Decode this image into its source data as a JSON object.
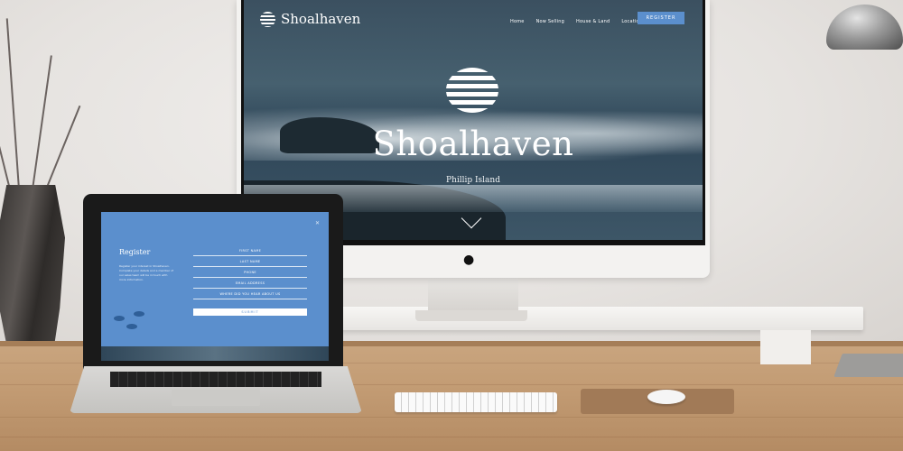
{
  "site": {
    "logo_text": "Shoalhaven",
    "logo_icon": "striped-sun-logo",
    "nav": [
      "Home",
      "Now Selling",
      "House & Land",
      "Location"
    ],
    "register_button": "REGISTER",
    "hero_title": "Shoalhaven",
    "hero_subtitle": "Phillip Island",
    "scroll_icon": "chevron-down-icon"
  },
  "laptop_form": {
    "heading": "Register",
    "intro": "Register your interest in Shoalhaven. Complete your details and a member of our sales team will be in touch with more information.",
    "fields": [
      "FIRST NAME",
      "LAST NAME",
      "PHONE",
      "EMAIL ADDRESS",
      "WHERE DID YOU HEAR ABOUT US"
    ],
    "submit_label": "SUBMIT",
    "close_icon": "close-icon"
  },
  "colors": {
    "accent_blue": "#5b8fcd",
    "hero_overlay": "#3b5060"
  },
  "icons": {
    "computer_brand": "apple-logo-icon"
  }
}
